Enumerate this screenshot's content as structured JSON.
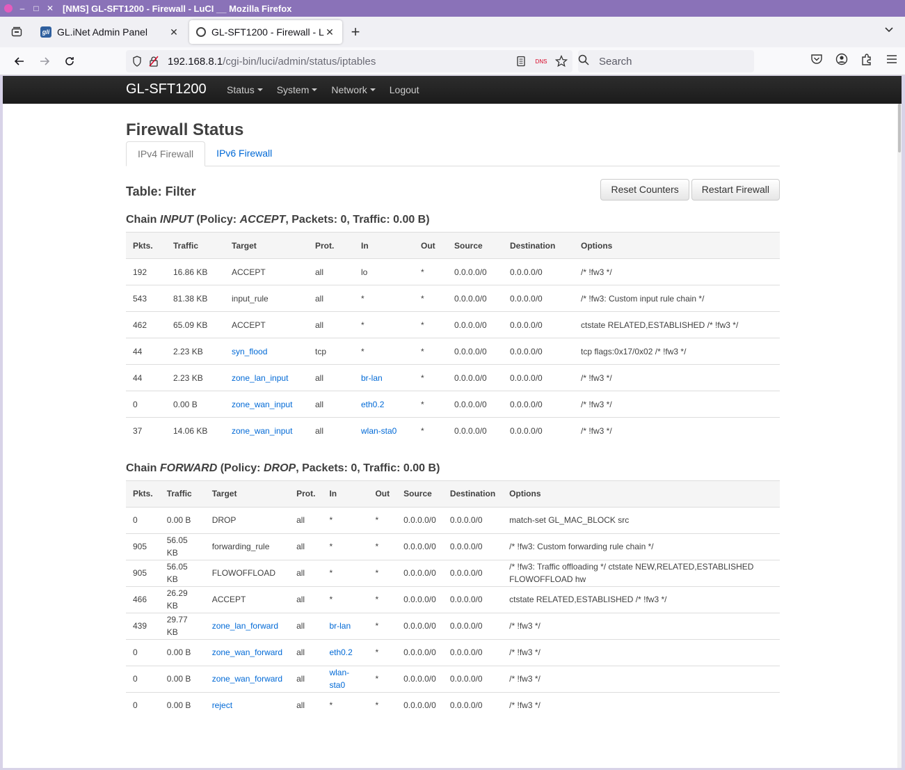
{
  "window": {
    "title": "[NMS] GL-SFT1200 - Firewall - LuCI __ Mozilla Firefox"
  },
  "browser": {
    "tabs": [
      {
        "label": "GL.iNet Admin Panel"
      },
      {
        "label": "GL-SFT1200 - Firewall - LuCI"
      }
    ],
    "url_host": "192.168.8.1",
    "url_path": "/cgi-bin/luci/admin/status/iptables",
    "dns_badge": "DNS",
    "search_placeholder": "Search"
  },
  "luci": {
    "brand": "GL-SFT1200",
    "menu": [
      "Status",
      "System",
      "Network",
      "Logout"
    ],
    "page_title": "Firewall Status",
    "tabs": [
      "IPv4 Firewall",
      "IPv6 Firewall"
    ],
    "table_title": "Table: Filter",
    "buttons": {
      "reset": "Reset Counters",
      "restart": "Restart Firewall"
    }
  },
  "input_chain": {
    "prefix": "Chain ",
    "name": "INPUT",
    "policy_prefix": " (Policy: ",
    "policy": "ACCEPT",
    "suffix": ", Packets: 0, Traffic: 0.00 B)",
    "headers": [
      "Pkts.",
      "Traffic",
      "Target",
      "Prot.",
      "In",
      "Out",
      "Source",
      "Destination",
      "Options"
    ],
    "rows": [
      {
        "pkts": "192",
        "traffic": "16.86 KB",
        "target": "ACCEPT",
        "target_link": false,
        "prot": "all",
        "in": "lo",
        "in_link": false,
        "out": "*",
        "src": "0.0.0.0/0",
        "dst": "0.0.0.0/0",
        "opts": "/* !fw3 */"
      },
      {
        "pkts": "543",
        "traffic": "81.38 KB",
        "target": "input_rule",
        "target_link": false,
        "prot": "all",
        "in": "*",
        "in_link": false,
        "out": "*",
        "src": "0.0.0.0/0",
        "dst": "0.0.0.0/0",
        "opts": "/* !fw3: Custom input rule chain */"
      },
      {
        "pkts": "462",
        "traffic": "65.09 KB",
        "target": "ACCEPT",
        "target_link": false,
        "prot": "all",
        "in": "*",
        "in_link": false,
        "out": "*",
        "src": "0.0.0.0/0",
        "dst": "0.0.0.0/0",
        "opts": "ctstate RELATED,ESTABLISHED /* !fw3 */"
      },
      {
        "pkts": "44",
        "traffic": "2.23 KB",
        "target": "syn_flood",
        "target_link": true,
        "prot": "tcp",
        "in": "*",
        "in_link": false,
        "out": "*",
        "src": "0.0.0.0/0",
        "dst": "0.0.0.0/0",
        "opts": "tcp flags:0x17/0x02 /* !fw3 */"
      },
      {
        "pkts": "44",
        "traffic": "2.23 KB",
        "target": "zone_lan_input",
        "target_link": true,
        "prot": "all",
        "in": "br-lan",
        "in_link": true,
        "out": "*",
        "src": "0.0.0.0/0",
        "dst": "0.0.0.0/0",
        "opts": "/* !fw3 */"
      },
      {
        "pkts": "0",
        "traffic": "0.00 B",
        "target": "zone_wan_input",
        "target_link": true,
        "prot": "all",
        "in": "eth0.2",
        "in_link": true,
        "out": "*",
        "src": "0.0.0.0/0",
        "dst": "0.0.0.0/0",
        "opts": "/* !fw3 */"
      },
      {
        "pkts": "37",
        "traffic": "14.06 KB",
        "target": "zone_wan_input",
        "target_link": true,
        "prot": "all",
        "in": "wlan-sta0",
        "in_link": true,
        "out": "*",
        "src": "0.0.0.0/0",
        "dst": "0.0.0.0/0",
        "opts": "/* !fw3 */"
      }
    ]
  },
  "forward_chain": {
    "prefix": "Chain ",
    "name": "FORWARD",
    "policy_prefix": " (Policy: ",
    "policy": "DROP",
    "suffix": ", Packets: 0, Traffic: 0.00 B)",
    "headers": [
      "Pkts.",
      "Traffic",
      "Target",
      "Prot.",
      "In",
      "Out",
      "Source",
      "Destination",
      "Options"
    ],
    "rows": [
      {
        "pkts": "0",
        "traffic": "0.00 B",
        "target": "DROP",
        "target_link": false,
        "prot": "all",
        "in": "*",
        "in_link": false,
        "out": "*",
        "src": "0.0.0.0/0",
        "dst": "0.0.0.0/0",
        "opts": "match-set GL_MAC_BLOCK src"
      },
      {
        "pkts": "905",
        "traffic": "56.05 KB",
        "target": "forwarding_rule",
        "target_link": false,
        "prot": "all",
        "in": "*",
        "in_link": false,
        "out": "*",
        "src": "0.0.0.0/0",
        "dst": "0.0.0.0/0",
        "opts": "/* !fw3: Custom forwarding rule chain */"
      },
      {
        "pkts": "905",
        "traffic": "56.05 KB",
        "target": "FLOWOFFLOAD",
        "target_link": false,
        "prot": "all",
        "in": "*",
        "in_link": false,
        "out": "*",
        "src": "0.0.0.0/0",
        "dst": "0.0.0.0/0",
        "opts": "/* !fw3: Traffic offloading */ ctstate NEW,RELATED,ESTABLISHED FLOWOFFLOAD hw"
      },
      {
        "pkts": "466",
        "traffic": "26.29 KB",
        "target": "ACCEPT",
        "target_link": false,
        "prot": "all",
        "in": "*",
        "in_link": false,
        "out": "*",
        "src": "0.0.0.0/0",
        "dst": "0.0.0.0/0",
        "opts": "ctstate RELATED,ESTABLISHED /* !fw3 */"
      },
      {
        "pkts": "439",
        "traffic": "29.77 KB",
        "target": "zone_lan_forward",
        "target_link": true,
        "prot": "all",
        "in": "br-lan",
        "in_link": true,
        "out": "*",
        "src": "0.0.0.0/0",
        "dst": "0.0.0.0/0",
        "opts": "/* !fw3 */"
      },
      {
        "pkts": "0",
        "traffic": "0.00 B",
        "target": "zone_wan_forward",
        "target_link": true,
        "prot": "all",
        "in": "eth0.2",
        "in_link": true,
        "out": "*",
        "src": "0.0.0.0/0",
        "dst": "0.0.0.0/0",
        "opts": "/* !fw3 */"
      },
      {
        "pkts": "0",
        "traffic": "0.00 B",
        "target": "zone_wan_forward",
        "target_link": true,
        "prot": "all",
        "in": "wlan-sta0",
        "in_link": true,
        "out": "*",
        "src": "0.0.0.0/0",
        "dst": "0.0.0.0/0",
        "opts": "/* !fw3 */"
      },
      {
        "pkts": "0",
        "traffic": "0.00 B",
        "target": "reject",
        "target_link": true,
        "prot": "all",
        "in": "*",
        "in_link": false,
        "out": "*",
        "src": "0.0.0.0/0",
        "dst": "0.0.0.0/0",
        "opts": "/* !fw3 */"
      }
    ]
  },
  "colors": {
    "link": "#0069d6",
    "header_bg": "#1b1b1b",
    "titlebar": "#8a72b8"
  }
}
